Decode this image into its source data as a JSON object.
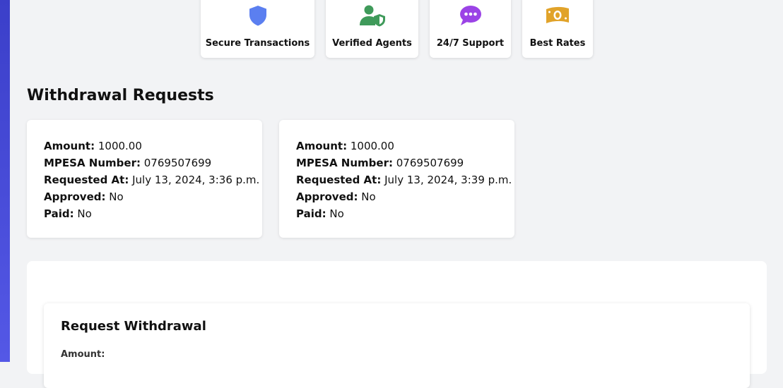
{
  "features": [
    {
      "label": "Secure Transactions",
      "icon": "shield-icon",
      "color": "#5b7ff0"
    },
    {
      "label": "Verified Agents",
      "icon": "user-shield-icon",
      "color": "#3f9a5a"
    },
    {
      "label": "24/7 Support",
      "icon": "chat-bubble-icon",
      "color": "#9b43e6"
    },
    {
      "label": "Best Rates",
      "icon": "money-bill-icon",
      "color": "#e1a32a"
    }
  ],
  "withdrawals": {
    "title": "Withdrawal Requests",
    "requests": [
      {
        "amount_label": "Amount:",
        "amount": "1000.00",
        "mpesa_label": "MPESA Number:",
        "mpesa": "0769507699",
        "requested_label": "Requested At:",
        "requested": "July 13, 2024, 3:36 p.m.",
        "approved_label": "Approved:",
        "approved": "No",
        "paid_label": "Paid:",
        "paid": "No"
      },
      {
        "amount_label": "Amount:",
        "amount": "1000.00",
        "mpesa_label": "MPESA Number:",
        "mpesa": "0769507699",
        "requested_label": "Requested At:",
        "requested": "July 13, 2024, 3:39 p.m.",
        "approved_label": "Approved:",
        "approved": "No",
        "paid_label": "Paid:",
        "paid": "No"
      }
    ]
  },
  "form": {
    "title": "Request Withdrawal",
    "amount_label": "Amount:"
  },
  "colors": {
    "sidebar": "#4649d8",
    "background": "#f2f3f5"
  }
}
